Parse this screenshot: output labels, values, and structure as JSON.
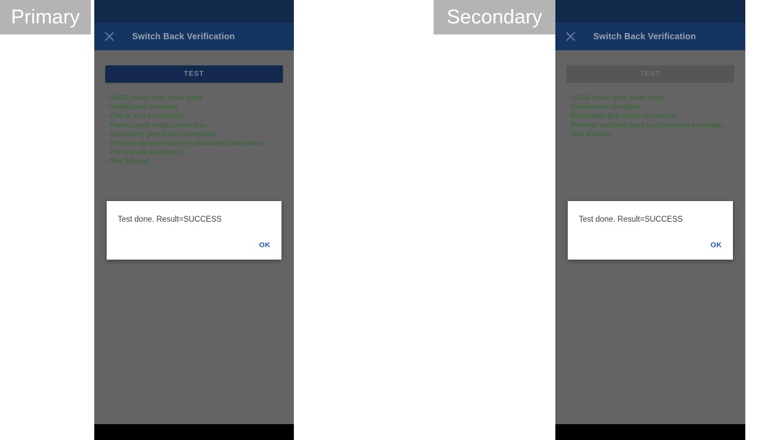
{
  "panels": [
    {
      "role_label": "Primary",
      "appbar": {
        "title": "Switch Back Verification",
        "close_icon": "close-icon"
      },
      "test_button": {
        "label": "TEST",
        "state": "enabled"
      },
      "log_lines": [
        "- SASS mode type: multi-point",
        "- Initialization complete",
        "- Check V2V connection.",
        "- Primary gets initial connection",
        "- Secondary gets initial connection",
        "- Provider switches back to disconnect secondary",
        "- Primary still connected.",
        "- Test finished"
      ],
      "dialog": {
        "message": "Test done. Result=SUCCESS",
        "ok_label": "OK"
      }
    },
    {
      "role_label": "Secondary",
      "appbar": {
        "title": "Switch Back Verification",
        "close_icon": "close-icon"
      },
      "test_button": {
        "label": "TEST",
        "state": "disabled"
      },
      "log_lines": [
        "- SASS mode type: multi-point",
        "- Initialization complete",
        "- Secondary gets initial connection",
        "- Provider switches back to disconnect secondary",
        "- Test finished"
      ],
      "dialog": {
        "message": "Test done. Result=SUCCESS",
        "ok_label": "OK"
      }
    }
  ],
  "colors": {
    "status_bar": "#11294b",
    "app_bar": "#143562",
    "dim_background": "#646464",
    "log_text": "#2f6b2b",
    "button_enabled": "#13294f",
    "button_disabled": "#565656",
    "ok_link": "#2453d6",
    "label_background": "#b4b4b4"
  }
}
